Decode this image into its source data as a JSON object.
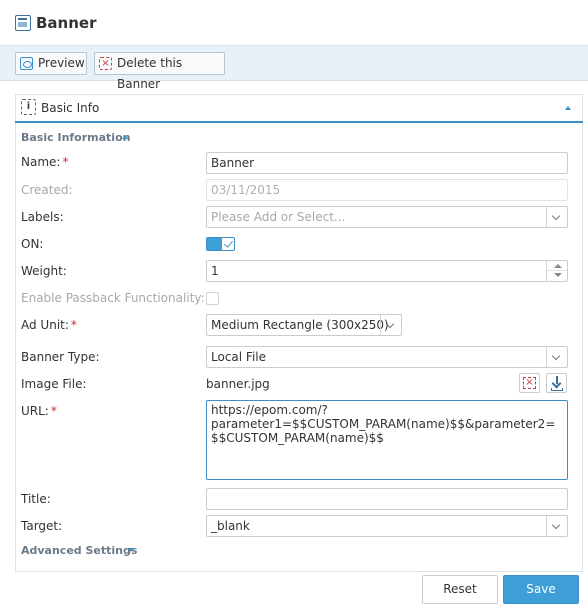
{
  "header": {
    "title": "Banner",
    "icon": "banner-icon"
  },
  "toolbar": {
    "preview_label": "Preview",
    "delete_label": "Delete this Banner"
  },
  "panel": {
    "title": "Basic Info",
    "section_basic": "Basic Information",
    "section_advanced": "Advanced Settings"
  },
  "form": {
    "name_label": "Name:",
    "name_value": "Banner",
    "created_label": "Created:",
    "created_value": "03/11/2015",
    "labels_label": "Labels:",
    "labels_placeholder": "Please Add or Select...",
    "on_label": "ON:",
    "on_value": true,
    "weight_label": "Weight:",
    "weight_value": "1",
    "passback_label": "Enable Passback Functionality:",
    "ad_unit_label": "Ad Unit:",
    "ad_unit_value": "Medium Rectangle (300x250)",
    "banner_type_label": "Banner Type:",
    "banner_type_value": "Local File",
    "image_file_label": "Image File:",
    "image_file_value": "banner.jpg",
    "url_label": "URL:",
    "url_value": "https://epom.com/?\nparameter1=$$CUSTOM_PARAM(name)$$&parameter2=$$CUSTOM_PARAM(name)$$",
    "title_label": "Title:",
    "title_value": "",
    "target_label": "Target:",
    "target_value": "_blank",
    "required_mark": "*"
  },
  "footer": {
    "reset_label": "Reset",
    "save_label": "Save"
  },
  "colors": {
    "accent": "#3d9fd6",
    "required": "#d62b2b",
    "toolbar_bg": "#e8f0f8"
  }
}
